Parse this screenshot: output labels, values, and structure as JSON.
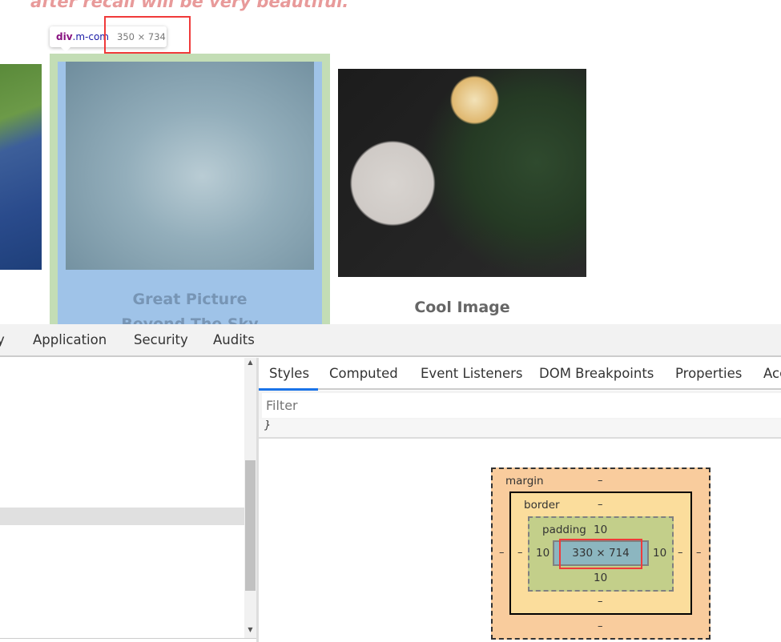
{
  "page": {
    "headline": "after recall will be very beautiful.",
    "cards": [
      {
        "title": "Great Picture",
        "subtitle": "Beyond The Sky"
      },
      {
        "title": "Cool Image"
      }
    ]
  },
  "inspector_tooltip": {
    "tag": "div",
    "class": ".m-com",
    "size": "350 × 734"
  },
  "devtools": {
    "main_tabs": [
      "y",
      "Application",
      "Security",
      "Audits"
    ],
    "side_tabs": [
      "Styles",
      "Computed",
      "Event Listeners",
      "DOM Breakpoints",
      "Properties",
      "Acc"
    ],
    "active_side_tab": "Styles",
    "filter_placeholder": "Filter",
    "rule_close": "}",
    "box_model": {
      "margin_label": "margin",
      "margin_top": "–",
      "margin_bottom": "–",
      "margin_left": "–",
      "margin_right": "–",
      "border_label": "border",
      "border_top": "–",
      "border_bottom": "–",
      "border_left": "–",
      "border_right": "–",
      "padding_label": "padding",
      "padding_top": "10",
      "padding_bottom": "10",
      "padding_left": "10",
      "padding_right": "10",
      "content_size": "330 × 714"
    },
    "colors": {
      "accent": "#1a73e8",
      "margin": "#f9cc9d",
      "border": "#fbdd9c",
      "padding": "#c3cf8a",
      "content": "#8cb6c0",
      "highlight": "#f03a3a"
    }
  }
}
